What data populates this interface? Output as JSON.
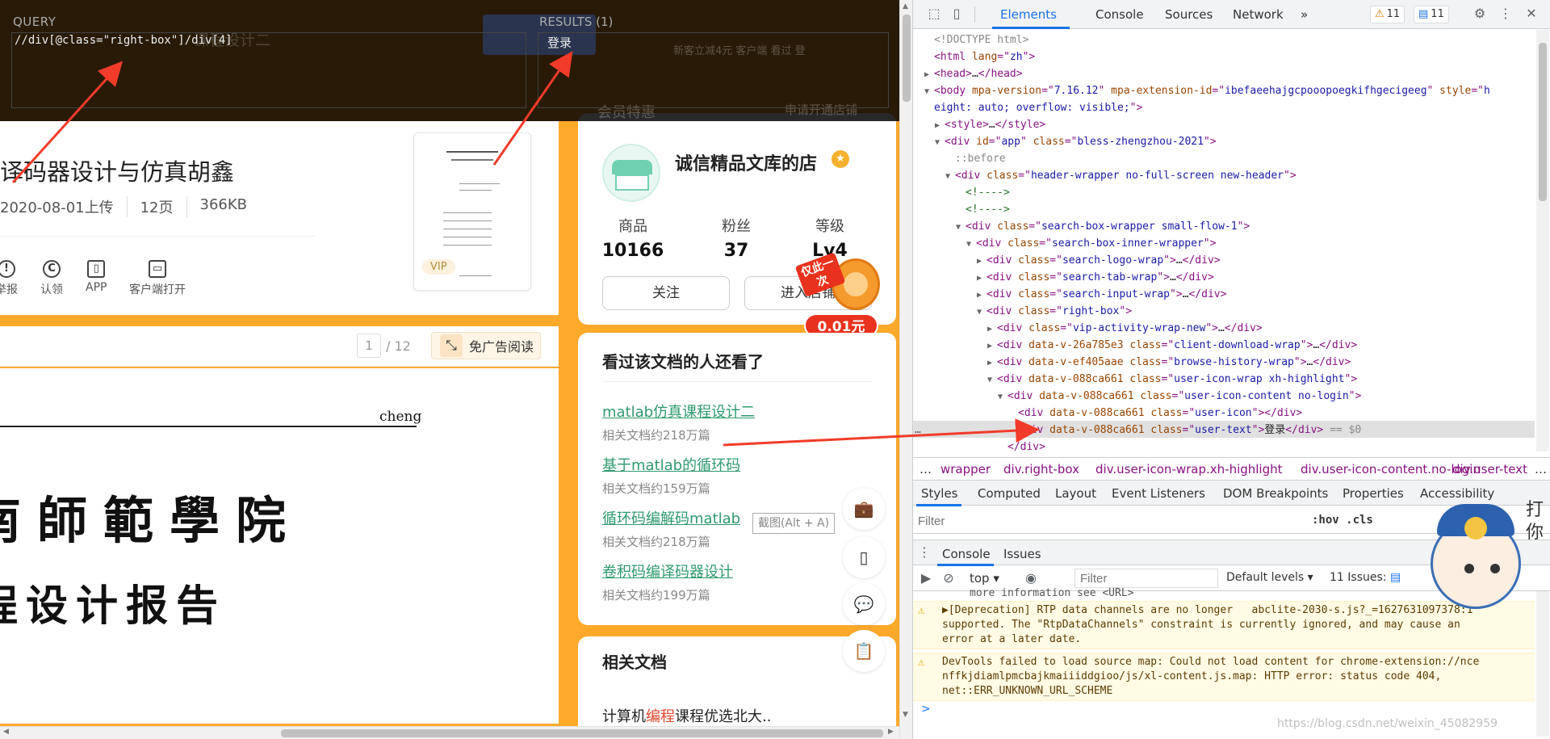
{
  "xpath_helper": {
    "query_label": "QUERY",
    "query": "//div[@class=\"right-box\"]/div[4]",
    "results_label": "RESULTS (1)",
    "result": "登录",
    "faded_behind": [
      "课程设计二",
      "新客立减4元  客户端  看过  登",
      "会员特惠",
      "申请开通店铺"
    ]
  },
  "document": {
    "title": "译码器设计与仿真胡鑫",
    "meta": [
      "2020-08-01上传",
      "12页",
      "366KB"
    ],
    "actions": [
      {
        "icon": "report-icon",
        "glyph": "!",
        "label": "举报"
      },
      {
        "icon": "copyright-icon",
        "glyph": "C",
        "label": "认领"
      },
      {
        "icon": "phone-icon",
        "glyph": "▯",
        "label": "APP"
      },
      {
        "icon": "monitor-icon",
        "glyph": "▭",
        "label": "客户端打开"
      }
    ],
    "thumb_badge": "VIP",
    "page_current": "1",
    "page_total": "/ 12",
    "ad_free_label": "免广告阅读",
    "page_text_author": "cheng",
    "page_text_school": "南師範學院",
    "page_text_report": "程设计报告"
  },
  "shop": {
    "name": "诚信精品文库的店",
    "stats": [
      {
        "label": "商品",
        "value": "10166"
      },
      {
        "label": "粉丝",
        "value": "37"
      },
      {
        "label": "等级",
        "value": "Lv4"
      }
    ],
    "follow_label": "关注",
    "enter_label": "进入店铺",
    "promo_tag": "仅此一次",
    "promo_price": "0.01元"
  },
  "recommend": {
    "title": "看过该文档的人还看了",
    "items": [
      {
        "title": "matlab仿真课程设计二",
        "sub": "相关文档约218万篇"
      },
      {
        "title": "基于matlab的循环码",
        "sub": "相关文档约159万篇"
      },
      {
        "title": "循环码编解码matlab",
        "sub": "相关文档约218万篇"
      },
      {
        "title": "卷积码编译码器设计",
        "sub": "相关文档约199万篇"
      }
    ]
  },
  "related": {
    "title": "相关文档",
    "item_prefix": "计算机",
    "item_highlight": "编程",
    "item_suffix": "课程优选北大.."
  },
  "screenshot_tip": "截图(Alt + A)",
  "devtools": {
    "tabs": [
      "Elements",
      "Console",
      "Sources",
      "Network"
    ],
    "more": "»",
    "warnings": "11",
    "infos": "11",
    "dom": [
      {
        "indent": 0,
        "tw": "",
        "html": "<span class='gray'>&lt;!DOCTYPE html&gt;</span>"
      },
      {
        "indent": 0,
        "tw": "",
        "html": "&lt;html <span class='attr'>lang</span>=\"<span class='val'>zh</span>\"&gt;"
      },
      {
        "indent": 0,
        "tw": "▶",
        "html": "&lt;head&gt;<span class='txt'>…</span>&lt;/head&gt;"
      },
      {
        "indent": 0,
        "tw": "▼",
        "html": "&lt;body <span class='attr'>mpa-version</span>=\"<span class='val'>7.16.12</span>\" <span class='attr'>mpa-extension-id</span>=\"<span class='val'>ibefaeehajgcpooopoegkifhgecigeeg</span>\" <span class='attr'>style</span>=\"<span class='val'>h</span>"
      },
      {
        "indent": -1,
        "tw": "",
        "html": "<span class='val'>eight: auto; overflow: visible;</span>\"&gt;"
      },
      {
        "indent": 1,
        "tw": "▶",
        "html": "&lt;style&gt;<span class='txt'>…</span>&lt;/style&gt;"
      },
      {
        "indent": 1,
        "tw": "▼",
        "html": "&lt;div <span class='attr'>id</span>=\"<span class='val'>app</span>\" <span class='attr'>class</span>=\"<span class='val'>bless-zhengzhou-2021</span>\"&gt;"
      },
      {
        "indent": 2,
        "tw": "",
        "html": "<span class='pseudo'>::before</span>"
      },
      {
        "indent": 2,
        "tw": "▼",
        "html": "&lt;div <span class='attr'>class</span>=\"<span class='val'>header-wrapper no-full-screen new-header</span>\"&gt;"
      },
      {
        "indent": 3,
        "tw": "",
        "html": "<span class='cmt'>&lt;!----&gt;</span>"
      },
      {
        "indent": 3,
        "tw": "",
        "html": "<span class='cmt'>&lt;!----&gt;</span>"
      },
      {
        "indent": 3,
        "tw": "▼",
        "html": "&lt;div <span class='attr'>class</span>=\"<span class='val'>search-box-wrapper small-flow-1</span>\"&gt;"
      },
      {
        "indent": 4,
        "tw": "▼",
        "html": "&lt;div <span class='attr'>class</span>=\"<span class='val'>search-box-inner-wrapper</span>\"&gt;"
      },
      {
        "indent": 5,
        "tw": "▶",
        "html": "&lt;div <span class='attr'>class</span>=\"<span class='val'>search-logo-wrap</span>\"&gt;<span class='txt'>…</span>&lt;/div&gt;"
      },
      {
        "indent": 5,
        "tw": "▶",
        "html": "&lt;div <span class='attr'>class</span>=\"<span class='val'>search-tab-wrap</span>\"&gt;<span class='txt'>…</span>&lt;/div&gt;"
      },
      {
        "indent": 5,
        "tw": "▶",
        "html": "&lt;div <span class='attr'>class</span>=\"<span class='val'>search-input-wrap</span>\"&gt;<span class='txt'>…</span>&lt;/div&gt;"
      },
      {
        "indent": 5,
        "tw": "▼",
        "html": "&lt;div <span class='attr'>class</span>=\"<span class='val'>right-box</span>\"&gt;"
      },
      {
        "indent": 6,
        "tw": "▶",
        "html": "&lt;div <span class='attr'>class</span>=\"<span class='val'>vip-activity-wrap-new</span>\"&gt;<span class='txt'>…</span>&lt;/div&gt;"
      },
      {
        "indent": 6,
        "tw": "▶",
        "html": "&lt;div <span class='attr'>data-v-26a785e3</span> <span class='attr'>class</span>=\"<span class='val'>client-download-wrap</span>\"&gt;<span class='txt'>…</span>&lt;/div&gt;"
      },
      {
        "indent": 6,
        "tw": "▶",
        "html": "&lt;div <span class='attr'>data-v-ef405aae</span> <span class='attr'>class</span>=\"<span class='val'>browse-history-wrap</span>\"&gt;<span class='txt'>…</span>&lt;/div&gt;"
      },
      {
        "indent": 6,
        "tw": "▼",
        "html": "&lt;div <span class='attr'>data-v-088ca661</span> <span class='attr'>class</span>=\"<span class='val'>user-icon-wrap xh-highlight</span>\"&gt;"
      },
      {
        "indent": 7,
        "tw": "▼",
        "html": "&lt;div <span class='attr'>data-v-088ca661</span> <span class='attr'>class</span>=\"<span class='val'>user-icon-content no-login</span>\"&gt;"
      },
      {
        "indent": 8,
        "tw": "",
        "html": "&lt;div <span class='attr'>data-v-088ca661</span> <span class='attr'>class</span>=\"<span class='val'>user-icon</span>\"&gt;&lt;/div&gt;"
      },
      {
        "indent": 8,
        "tw": "",
        "html": "&lt;div <span class='attr'>data-v-088ca661</span> <span class='attr'>class</span>=\"<span class='val'>user-text</span>\"&gt;<span class='txt'>登录</span>&lt;/div&gt; <span class='gray'>== $0</span>"
      },
      {
        "indent": 7,
        "tw": "",
        "html": "&lt;/div&gt;"
      }
    ],
    "breadcrumb": [
      "…",
      "wrapper",
      "div.right-box",
      "div.user-icon-wrap.xh-highlight",
      "div.user-icon-content.no-login",
      "div.user-text",
      "…"
    ],
    "subtabs": [
      "Styles",
      "Computed",
      "Layout",
      "Event Listeners",
      "DOM Breakpoints",
      "Properties",
      "Accessibility"
    ],
    "filter_placeholder": "Filter",
    "hov_cls": ":hov .cls",
    "drawer_tabs": [
      "Console",
      "Issues"
    ],
    "console_context": "top",
    "console_filter_placeholder": "Filter",
    "levels": "Default levels",
    "issues": "11 Issues:",
    "messages": [
      "more information see <URL>",
      "▶[Deprecation] RTP data channels are no longer   abclite-2030-s.js?_=1627631097378:1\nsupported. The \"RtpDataChannels\" constraint is currently ignored, and may cause an\nerror at a later date.",
      "DevTools failed to load source map: Could not load content for chrome-extension://nce\nnffkjdiamlpmcbajkmaiiiddgioo/js/xl-content.js.map: HTTP error: status code 404,\nnet::ERR_UNKNOWN_URL_SCHEME"
    ],
    "prompt": ">"
  },
  "mascot_text": "打你",
  "watermark": "https://blog.csdn.net/weixin_45082959"
}
